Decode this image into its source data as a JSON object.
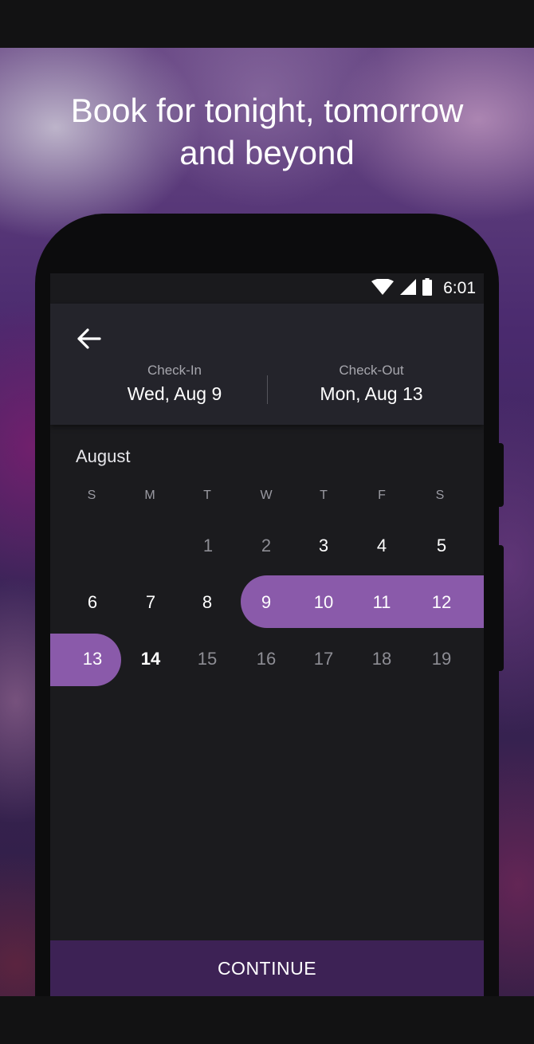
{
  "headline": {
    "line1": "Book for tonight, tomorrow",
    "line2": "and beyond"
  },
  "status_bar": {
    "time": "6:01",
    "icons": [
      "wifi-icon",
      "cellular-signal-icon",
      "battery-icon"
    ]
  },
  "header": {
    "back_icon": "arrow-left-icon",
    "check_in": {
      "label": "Check-In",
      "value": "Wed, Aug 9"
    },
    "check_out": {
      "label": "Check-Out",
      "value": "Mon, Aug 13"
    }
  },
  "calendar": {
    "month": "August",
    "weekdays": [
      "S",
      "M",
      "T",
      "W",
      "T",
      "F",
      "S"
    ],
    "weeks": [
      [
        "",
        "",
        "1",
        "2",
        "3",
        "4",
        "5"
      ],
      [
        "6",
        "7",
        "8",
        "9",
        "10",
        "11",
        "12"
      ],
      [
        "13",
        "14",
        "15",
        "16",
        "17",
        "18",
        "19"
      ]
    ],
    "selected_range": {
      "start": "9",
      "end": "13"
    },
    "accent_color": "#8a5aaa"
  },
  "footer": {
    "continue_label": "CONTINUE",
    "button_color": "#3d2255"
  }
}
